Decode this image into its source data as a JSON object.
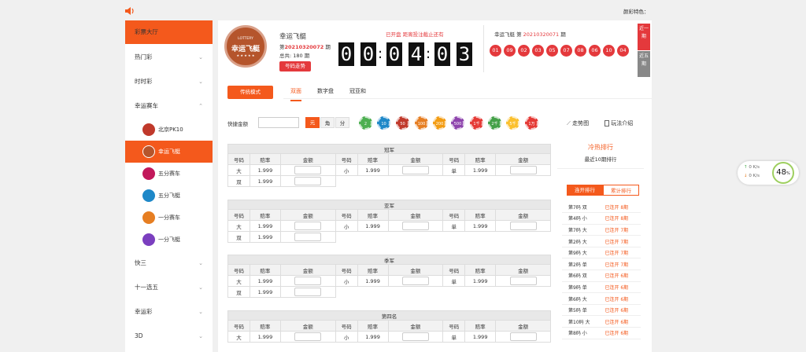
{
  "topbar": {
    "color_label": "颜彩特色："
  },
  "sidebar": {
    "items": [
      {
        "label": "彩票大厅"
      },
      {
        "label": "热门彩"
      },
      {
        "label": "时时彩"
      },
      {
        "label": "幸运赛车"
      },
      {
        "label": "快三"
      },
      {
        "label": "十一选五"
      },
      {
        "label": "幸运彩"
      },
      {
        "label": "3D"
      }
    ],
    "sub_items": [
      {
        "label": "北京PK10",
        "color": "#c0392b"
      },
      {
        "label": "幸运飞艇",
        "color": "#b5552c"
      },
      {
        "label": "五分赛车",
        "color": "#c2185b"
      },
      {
        "label": "五分飞艇",
        "color": "#1e88c8"
      },
      {
        "label": "一分赛车",
        "color": "#e67e22"
      },
      {
        "label": "一分飞艇",
        "color": "#7b3fbf"
      }
    ]
  },
  "game": {
    "name": "幸运飞艇",
    "period_prefix": "第",
    "period": "20210320072",
    "period_suffix": "期",
    "total_prefix": "总共:",
    "total": "180",
    "total_suffix": "期",
    "trend_button": "号码走势",
    "logo_top": "LOTTERY",
    "logo_main": "幸运飞艇",
    "countdown_label": "已开盘 距离投注截止还有",
    "countdown": [
      "0",
      "0",
      "0",
      "4",
      "0",
      "3"
    ],
    "last_title": "幸运飞艇 第",
    "last_period": "20210320071",
    "last_suffix": "期",
    "last_balls": [
      "01",
      "09",
      "02",
      "03",
      "05",
      "07",
      "08",
      "06",
      "10",
      "04"
    ],
    "recent1": "近一期",
    "recent5": "近五期"
  },
  "tabs": {
    "mode": "传统模式",
    "items": [
      "双面",
      "数字盘",
      "冠亚和"
    ]
  },
  "quick": {
    "label": "快捷金额",
    "units": [
      "元",
      "角",
      "分"
    ],
    "chips": [
      {
        "label": "2",
        "color": "#4caf50"
      },
      {
        "label": "10",
        "color": "#1e88c8"
      },
      {
        "label": "50",
        "color": "#c0392b"
      },
      {
        "label": "100",
        "color": "#e67e22"
      },
      {
        "label": "200",
        "color": "#f39c12"
      },
      {
        "label": "500",
        "color": "#8e44ad"
      },
      {
        "label": "1千",
        "color": "#e53935"
      },
      {
        "label": "2千",
        "color": "#43a047"
      },
      {
        "label": "5千",
        "color": "#fbc02d"
      },
      {
        "label": "1万",
        "color": "#e53935"
      }
    ],
    "trend_link": "走势图",
    "rules_link": "玩法介绍"
  },
  "bet_tables": {
    "headers": [
      "号码",
      "赔率",
      "金额"
    ],
    "sections": [
      {
        "title": "冠军",
        "row1": [
          "大",
          "1.999",
          "小",
          "1.999",
          "单",
          "1.999"
        ],
        "row2": [
          "双",
          "1.999"
        ]
      },
      {
        "title": "亚军",
        "row1": [
          "大",
          "1.999",
          "小",
          "1.999",
          "单",
          "1.999"
        ],
        "row2": [
          "双",
          "1.999"
        ]
      },
      {
        "title": "季军",
        "row1": [
          "大",
          "1.999",
          "小",
          "1.999",
          "单",
          "1.999"
        ],
        "row2": [
          "双",
          "1.999"
        ]
      },
      {
        "title": "第四名",
        "row1": [
          "大",
          "1.999",
          "小",
          "1.999",
          "单",
          "1.999"
        ],
        "row2": []
      }
    ]
  },
  "ranking": {
    "title": "冷热排行",
    "subtitle": "最近10期排行",
    "tab_active": "连开排行",
    "tab_inactive": "累计排行",
    "rows": [
      {
        "name": "第7码 双",
        "value": "已连开 8期"
      },
      {
        "name": "第4码 小",
        "value": "已连开 8期"
      },
      {
        "name": "第7码 大",
        "value": "已连开 7期"
      },
      {
        "name": "第2码 大",
        "value": "已连开 7期"
      },
      {
        "name": "第9码 大",
        "value": "已连开 7期"
      },
      {
        "name": "第2码 单",
        "value": "已连开 7期"
      },
      {
        "name": "第6码 双",
        "value": "已连开 6期"
      },
      {
        "name": "第9码 单",
        "value": "已连开 6期"
      },
      {
        "name": "第6码 大",
        "value": "已连开 6期"
      },
      {
        "name": "第5码 单",
        "value": "已连开 6期"
      },
      {
        "name": "第10码 大",
        "value": "已连开 6期"
      },
      {
        "name": "第8码 小",
        "value": "已连开 6期"
      }
    ]
  },
  "netspeed": {
    "up": "0",
    "down": "0",
    "unit": "K/s",
    "percent": "48",
    "percent_unit": "%"
  }
}
